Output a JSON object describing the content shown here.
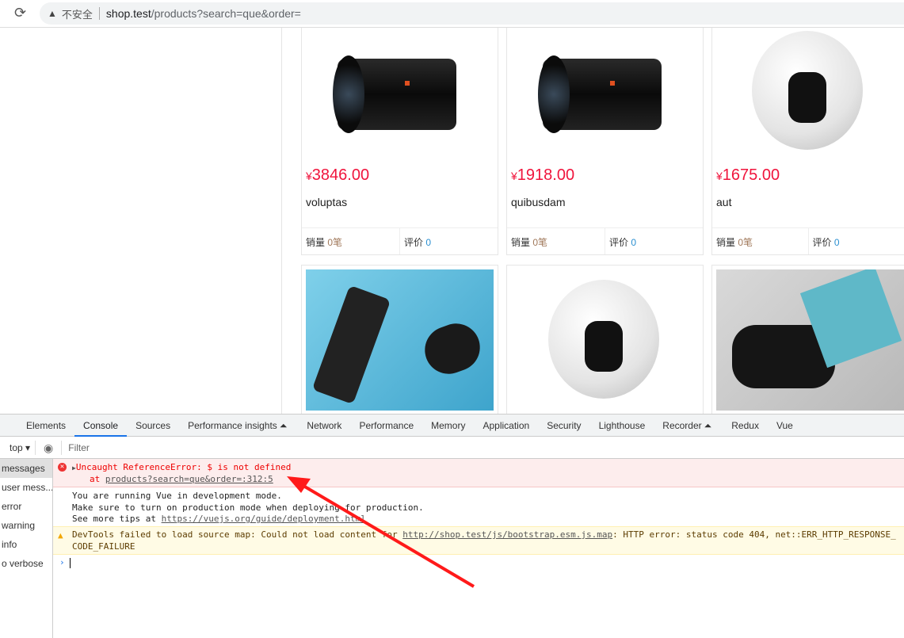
{
  "browser": {
    "security_label": "不安全",
    "url_host": "shop.test",
    "url_path": "/products?search=que&order="
  },
  "products": [
    {
      "price_symbol": "¥",
      "price": "3846.00",
      "name": "voluptas",
      "sales_label": "销量",
      "sales": "0笔",
      "reviews_label": "评价",
      "reviews": "0",
      "image": "camera-lens"
    },
    {
      "price_symbol": "¥",
      "price": "1918.00",
      "name": "quibusdam",
      "sales_label": "销量",
      "sales": "0笔",
      "reviews_label": "评价",
      "reviews": "0",
      "image": "camera-lens"
    },
    {
      "price_symbol": "¥",
      "price": "1675.00",
      "name": "aut",
      "sales_label": "销量",
      "sales": "0笔",
      "reviews_label": "评价",
      "reviews": "0",
      "image": "360-camera"
    },
    {
      "image": "phone-lens-kit"
    },
    {
      "image": "360-camera"
    },
    {
      "image": "game-controller"
    }
  ],
  "devtools": {
    "tabs": [
      "Elements",
      "Console",
      "Sources",
      "Performance insights",
      "Network",
      "Performance",
      "Memory",
      "Application",
      "Security",
      "Lighthouse",
      "Recorder",
      "Redux",
      "Vue"
    ],
    "active_tab": "Console",
    "context": "top",
    "filter_placeholder": "Filter",
    "sidebar": [
      "messages",
      "user mess...",
      "error",
      "warning",
      "info",
      "o verbose"
    ],
    "error": {
      "text": "Uncaught ReferenceError: $ is not defined",
      "at": "at ",
      "link": "products?search=que&order=:312:5"
    },
    "info": {
      "line1": "You are running Vue in development mode.",
      "line2": "Make sure to turn on production mode when deploying for production.",
      "line3_prefix": "See more tips at ",
      "line3_link": "https://vuejs.org/guide/deployment.html"
    },
    "warning": {
      "prefix": "DevTools failed to load source map: Could not load content for ",
      "link": "http://shop.test/js/bootstrap.esm.js.map",
      "suffix": ": HTTP error: status code 404, net::ERR_HTTP_RESPONSE_CODE_FAILURE"
    }
  },
  "colors": {
    "price": "#f0143c",
    "annotation_arrow": "#ff1a1a",
    "active_tab": "#1a73e8"
  }
}
